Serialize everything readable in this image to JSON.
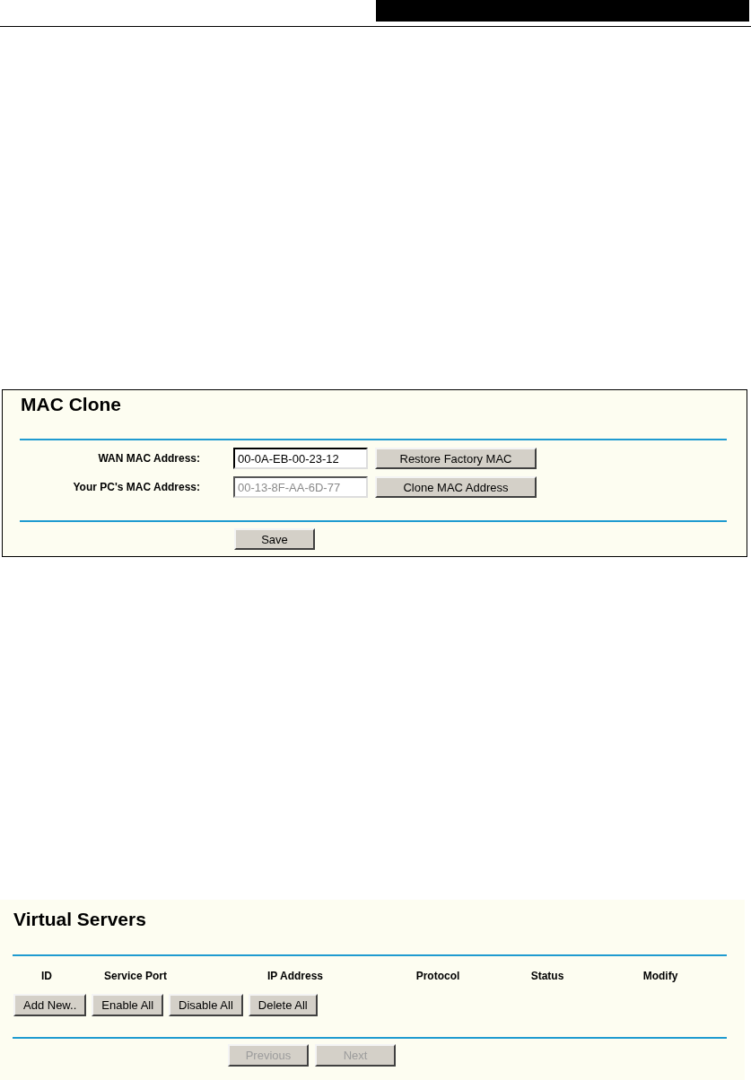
{
  "mac_clone": {
    "title": "MAC Clone",
    "fields": [
      {
        "label": "WAN MAC Address:",
        "value": "00-0A-EB-00-23-12",
        "disabled": false,
        "button": "Restore Factory MAC"
      },
      {
        "label": "Your PC's MAC Address:",
        "value": "00-13-8F-AA-6D-77",
        "disabled": true,
        "button": "Clone MAC Address"
      }
    ],
    "save_button": "Save"
  },
  "virtual_servers": {
    "title": "Virtual Servers",
    "columns": [
      "ID",
      "Service Port",
      "IP Address",
      "Protocol",
      "Status",
      "Modify"
    ],
    "actions": [
      "Add New..",
      "Enable All",
      "Disable All",
      "Delete All"
    ],
    "pager": [
      {
        "label": "Previous",
        "disabled": true
      },
      {
        "label": "Next",
        "disabled": true
      }
    ]
  }
}
